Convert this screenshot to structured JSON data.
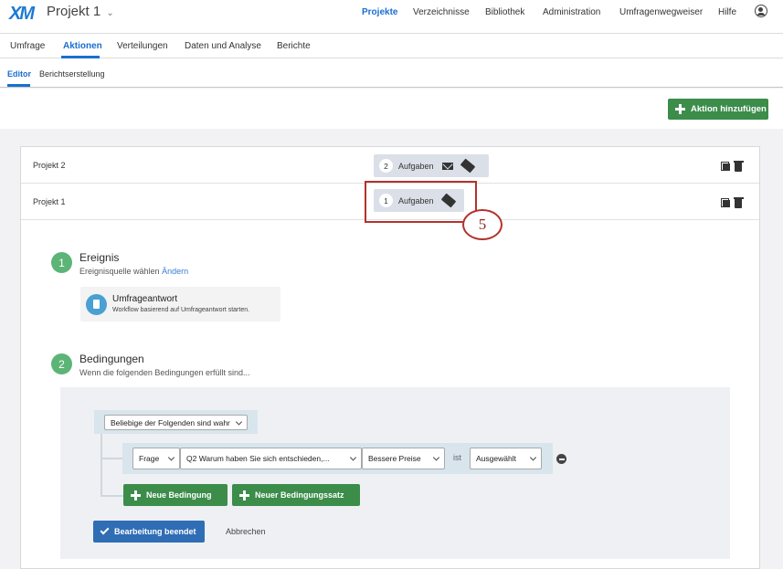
{
  "header": {
    "logo": "XM",
    "project": "Projekt 1",
    "nav": [
      "Projekte",
      "Verzeichnisse",
      "Bibliothek",
      "Administration",
      "Umfragenwegweiser",
      "Hilfe"
    ]
  },
  "tabs": [
    "Umfrage",
    "Aktionen",
    "Verteilungen",
    "Daten und Analyse",
    "Berichte"
  ],
  "subtabs": [
    "Editor",
    "Berichtserstellung"
  ],
  "toolbar": {
    "add_action": "Aktion hinzufügen"
  },
  "workflows": [
    {
      "name": "Projekt 2",
      "count": "2",
      "label": "Aufgaben"
    },
    {
      "name": "Projekt 1",
      "count": "1",
      "label": "Aufgaben"
    }
  ],
  "callout": "5",
  "event": {
    "number": "1",
    "title": "Ereignis",
    "subtitle": "Ereignisquelle wählen",
    "change_link": "Ändern",
    "source_title": "Umfrageantwort",
    "source_desc": "Workflow basierend auf Umfrageantwort starten."
  },
  "conditions": {
    "number": "2",
    "title": "Bedingungen",
    "subtitle": "Wenn die folgenden Bedingungen erfüllt sind...",
    "any_select": "Beliebige der Folgenden sind wahr",
    "field_type": "Frage",
    "question": "Q2 Warum haben Sie sich entschieden,...",
    "answer": "Bessere Preise",
    "operator": "ist",
    "state": "Ausgewählt",
    "new_condition": "Neue Bedingung",
    "new_condition_set": "Neuer Bedingungssatz",
    "done": "Bearbeitung beendet",
    "cancel": "Abbrechen"
  }
}
